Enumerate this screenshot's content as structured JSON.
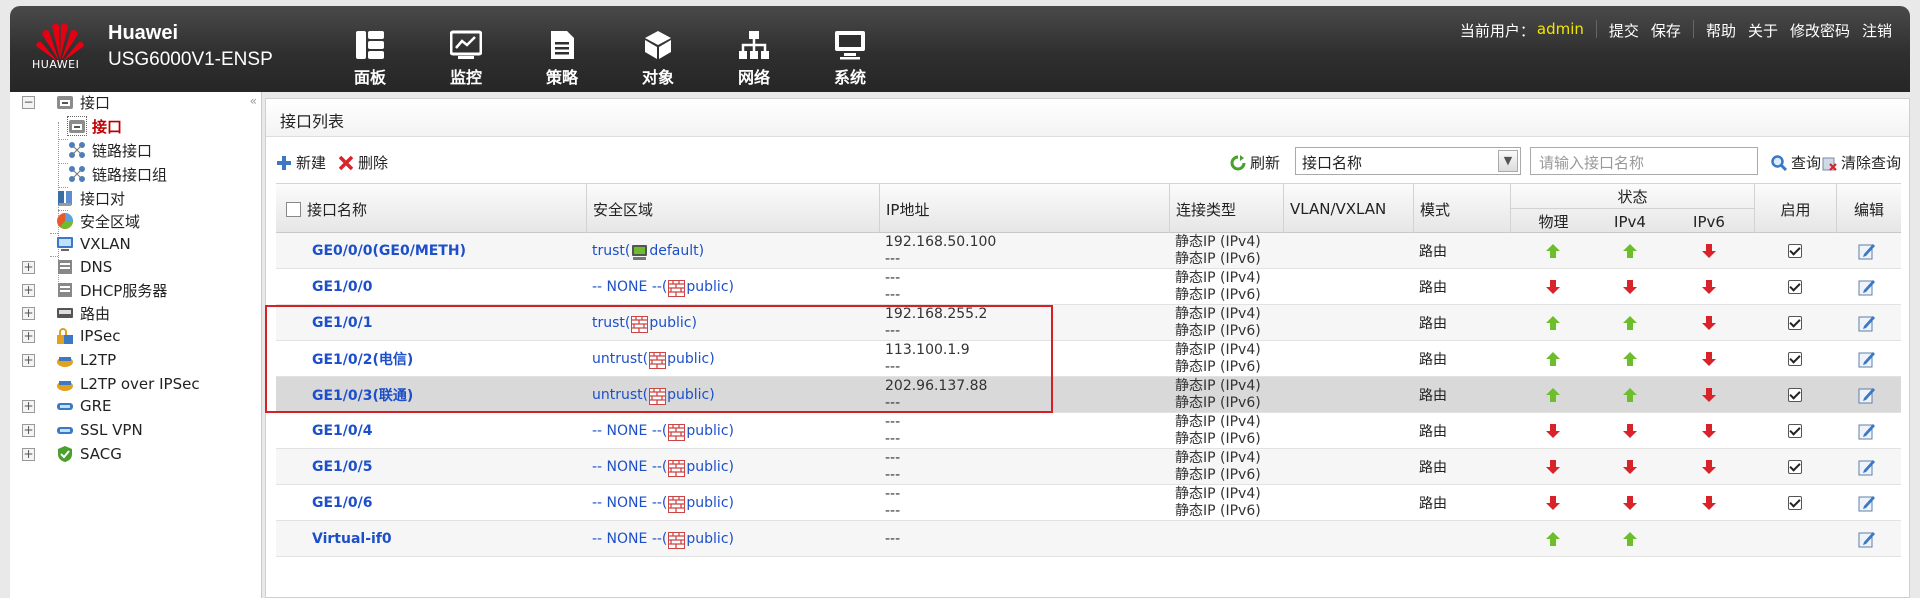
{
  "header": {
    "logo_text": "HUAWEI",
    "brand": "Huawei",
    "model": "USG6000V1-ENSP",
    "nav": [
      {
        "label": "面板",
        "icon": "dashboard-icon"
      },
      {
        "label": "监控",
        "icon": "monitor-chart-icon"
      },
      {
        "label": "策略",
        "icon": "policy-document-icon"
      },
      {
        "label": "对象",
        "icon": "object-cube-icon"
      },
      {
        "label": "网络",
        "icon": "network-topology-icon",
        "active": true
      },
      {
        "label": "系统",
        "icon": "system-computer-icon"
      }
    ],
    "user_label": "当前用户：",
    "user_name": "admin",
    "actions": {
      "submit": "提交",
      "save": "保存",
      "help": "帮助",
      "about": "关于",
      "change_password": "修改密码",
      "logout": "注销"
    }
  },
  "sidebar": {
    "items": [
      {
        "label": "接口"
      },
      {
        "label": "接口"
      },
      {
        "label": "链路接口"
      },
      {
        "label": "链路接口组"
      },
      {
        "label": "接口对"
      },
      {
        "label": "安全区域"
      },
      {
        "label": "VXLAN"
      },
      {
        "label": "DNS"
      },
      {
        "label": "DHCP服务器"
      },
      {
        "label": "路由"
      },
      {
        "label": "IPSec"
      },
      {
        "label": "L2TP"
      },
      {
        "label": "L2TP over IPSec"
      },
      {
        "label": "GRE"
      },
      {
        "label": "SSL VPN"
      },
      {
        "label": "SACG"
      }
    ]
  },
  "panel": {
    "title": "接口列表"
  },
  "toolbar": {
    "new": "新建",
    "delete": "删除",
    "refresh": "刷新",
    "filter_value": "接口名称",
    "search_placeholder": "请输入接口名称",
    "query": "查询",
    "clear_query": "清除查询"
  },
  "table": {
    "columns": {
      "name": "接口名称",
      "zone": "安全区域",
      "ip": "IP地址",
      "conn": "连接类型",
      "vlan": "VLAN/VXLAN",
      "mode": "模式",
      "status": "状态",
      "physical": "物理",
      "ipv4": "IPv4",
      "ipv6": "IPv6",
      "enable": "启用",
      "edit": "编辑"
    },
    "rows": [
      {
        "name": "GE0/0/0(GE0/METH)",
        "zone_prefix": "trust(",
        "zone_icon": "vsys-icon",
        "zone_name": "default)",
        "ip1": "192.168.50.100",
        "ip2": "---",
        "conn1": "静态IP (IPv4)",
        "conn2": "静态IP (IPv6)",
        "mode": "路由",
        "phys": "up",
        "v4": "up",
        "v6": "down",
        "enabled": true
      },
      {
        "name": "GE1/0/0",
        "zone_prefix": "-- NONE --(",
        "zone_icon": "firewall-icon",
        "zone_name": "public)",
        "ip1": "---",
        "ip2": "---",
        "conn1": "静态IP (IPv4)",
        "conn2": "静态IP (IPv6)",
        "mode": "路由",
        "phys": "down",
        "v4": "down",
        "v6": "down",
        "enabled": true
      },
      {
        "name": "GE1/0/1",
        "zone_prefix": "trust(",
        "zone_icon": "firewall-icon",
        "zone_name": "public)",
        "ip1": "192.168.255.2",
        "ip2": "---",
        "conn1": "静态IP (IPv4)",
        "conn2": "静态IP (IPv6)",
        "mode": "路由",
        "phys": "up",
        "v4": "up",
        "v6": "down",
        "enabled": true
      },
      {
        "name": "GE1/0/2(电信)",
        "zone_prefix": "untrust(",
        "zone_icon": "firewall-icon",
        "zone_name": "public)",
        "ip1": "113.100.1.9",
        "ip2": "---",
        "conn1": "静态IP (IPv4)",
        "conn2": "静态IP (IPv6)",
        "mode": "路由",
        "phys": "up",
        "v4": "up",
        "v6": "down",
        "enabled": true
      },
      {
        "name": "GE1/0/3(联通)",
        "zone_prefix": "untrust(",
        "zone_icon": "firewall-icon",
        "zone_name": "public)",
        "ip1": "202.96.137.88",
        "ip2": "---",
        "conn1": "静态IP (IPv4)",
        "conn2": "静态IP (IPv6)",
        "mode": "路由",
        "phys": "up",
        "v4": "up",
        "v6": "down",
        "enabled": true
      },
      {
        "name": "GE1/0/4",
        "zone_prefix": "-- NONE --(",
        "zone_icon": "firewall-icon",
        "zone_name": "public)",
        "ip1": "---",
        "ip2": "---",
        "conn1": "静态IP (IPv4)",
        "conn2": "静态IP (IPv6)",
        "mode": "路由",
        "phys": "down",
        "v4": "down",
        "v6": "down",
        "enabled": true
      },
      {
        "name": "GE1/0/5",
        "zone_prefix": "-- NONE --(",
        "zone_icon": "firewall-icon",
        "zone_name": "public)",
        "ip1": "---",
        "ip2": "---",
        "conn1": "静态IP (IPv4)",
        "conn2": "静态IP (IPv6)",
        "mode": "路由",
        "phys": "down",
        "v4": "down",
        "v6": "down",
        "enabled": true
      },
      {
        "name": "GE1/0/6",
        "zone_prefix": "-- NONE --(",
        "zone_icon": "firewall-icon",
        "zone_name": "public)",
        "ip1": "---",
        "ip2": "---",
        "conn1": "静态IP (IPv4)",
        "conn2": "静态IP (IPv6)",
        "mode": "路由",
        "phys": "down",
        "v4": "down",
        "v6": "down",
        "enabled": true
      },
      {
        "name": "Virtual-if0",
        "zone_prefix": "-- NONE --(",
        "zone_icon": "firewall-icon",
        "zone_name": "public)",
        "ip1": "---",
        "ip2": "",
        "conn1": "",
        "conn2": "",
        "mode": "",
        "phys": "up",
        "v4": "up",
        "v6": "",
        "enabled": false
      }
    ]
  },
  "colors": {
    "accent_link": "#1c4fc9",
    "up_arrow": "#6cbf2a",
    "down_arrow": "#d9232b",
    "highlight_box": "#d61f26",
    "username": "#f2e600"
  }
}
